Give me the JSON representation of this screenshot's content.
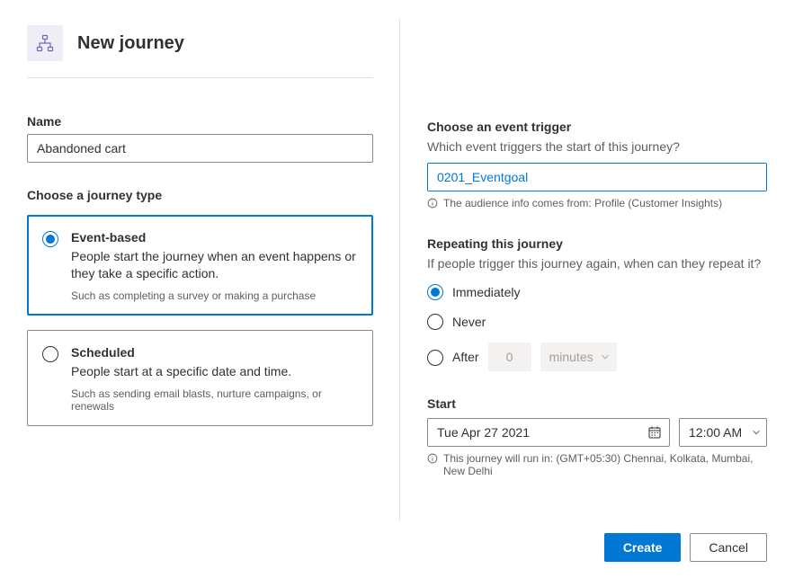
{
  "header": {
    "title": "New journey"
  },
  "name_field": {
    "label": "Name",
    "value": "Abandoned cart"
  },
  "journey_type": {
    "label": "Choose a journey type",
    "options": [
      {
        "title": "Event-based",
        "desc": "People start the journey when an event happens or they take a specific action.",
        "example": "Such as completing a survey or making a purchase",
        "selected": true
      },
      {
        "title": "Scheduled",
        "desc": "People start at a specific date and time.",
        "example": "Such as sending email blasts, nurture campaigns, or renewals",
        "selected": false
      }
    ]
  },
  "trigger": {
    "label": "Choose an event trigger",
    "desc": "Which event triggers the start of this journey?",
    "value": "0201_Eventgoal",
    "info": "The audience info comes from: Profile (Customer Insights)"
  },
  "repeat": {
    "label": "Repeating this journey",
    "desc": "If people trigger this journey again, when can they repeat it?",
    "options": {
      "immediately": "Immediately",
      "never": "Never",
      "after": "After"
    },
    "after_value": "0",
    "after_unit": "minutes",
    "selected": "immediately"
  },
  "start": {
    "label": "Start",
    "date": "Tue Apr 27 2021",
    "time": "12:00 AM",
    "info": "This journey will run in: (GMT+05:30) Chennai, Kolkata, Mumbai, New Delhi"
  },
  "footer": {
    "create": "Create",
    "cancel": "Cancel"
  }
}
